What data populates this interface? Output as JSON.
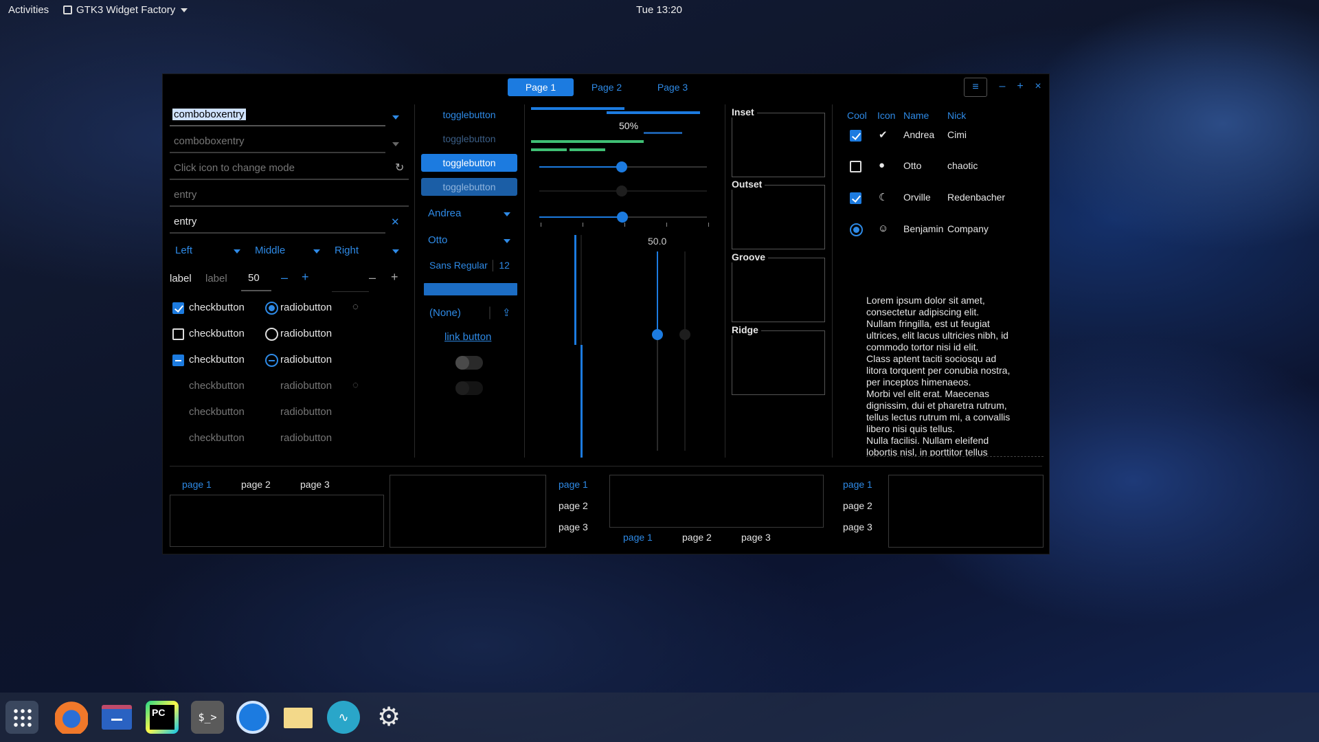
{
  "topbar": {
    "activities": "Activities",
    "app_name": "GTK3 Widget Factory",
    "clock": "Tue 13:20"
  },
  "headerbar": {
    "tabs": [
      "Page 1",
      "Page 2",
      "Page 3"
    ],
    "menu_icon": "hamburger-menu-icon",
    "controls": [
      "–",
      "+",
      "×"
    ]
  },
  "col1": {
    "combo1": "comboboxentry",
    "combo2": "comboboxentry",
    "mode_entry_placeholder": "Click icon to change mode",
    "entry_placeholder": "entry",
    "entry_value": "entry",
    "align_combos": [
      "Left",
      "Middle",
      "Right"
    ],
    "label1": "label",
    "label2": "label",
    "spin_value": "50",
    "spin_minus": "–",
    "spin_plus": "+",
    "checkbutton": "checkbutton",
    "radiobutton": "radiobutton"
  },
  "col2": {
    "toggle": "togglebutton",
    "combo_andrea": "Andrea",
    "combo_otto": "Otto",
    "font_name": "Sans Regular",
    "font_size": "12",
    "file_none": "(None)",
    "link": "link button"
  },
  "col3": {
    "progress_label": "50%",
    "scale_value": "50.0",
    "progress_fraction": 0.5
  },
  "frames": [
    "Inset",
    "Outset",
    "Groove",
    "Ridge"
  ],
  "tree": {
    "headers": [
      "Cool",
      "Icon",
      "Name",
      "Nick"
    ],
    "rows": [
      {
        "name": "Andrea",
        "nick": "Cimi",
        "icon": "check-circle-icon"
      },
      {
        "name": "Otto",
        "nick": "chaotic",
        "icon": "alert-circle-icon"
      },
      {
        "name": "Orville",
        "nick": "Redenbacher",
        "icon": "moon-icon"
      },
      {
        "name": "Benjamin",
        "nick": "Company",
        "icon": "face-icon"
      }
    ]
  },
  "lorem": [
    "Lorem ipsum dolor sit amet,",
    "consectetur adipiscing elit.",
    "Nullam fringilla, est ut feugiat",
    "ultrices, elit lacus ultricies nibh, id",
    "commodo tortor nisi id elit.",
    "Class aptent taciti sociosqu ad",
    "litora torquent per conubia nostra,",
    "per inceptos himenaeos.",
    "Morbi vel elit erat. Maecenas",
    "dignissim, dui et pharetra rutrum,",
    "tellus lectus rutrum mi, a convallis",
    "libero nisi quis tellus.",
    "Nulla facilisi. Nullam eleifend",
    "lobortis nisl, in porttitor tellus"
  ],
  "notebooks": {
    "tabs": [
      "page 1",
      "page 2",
      "page 3"
    ]
  },
  "dock": [
    "apps-grid-icon",
    "firefox-icon",
    "files-icon",
    "pycharm-icon",
    "terminal-icon",
    "updater-icon",
    "mail-icon",
    "audio-icon",
    "settings-icon"
  ]
}
